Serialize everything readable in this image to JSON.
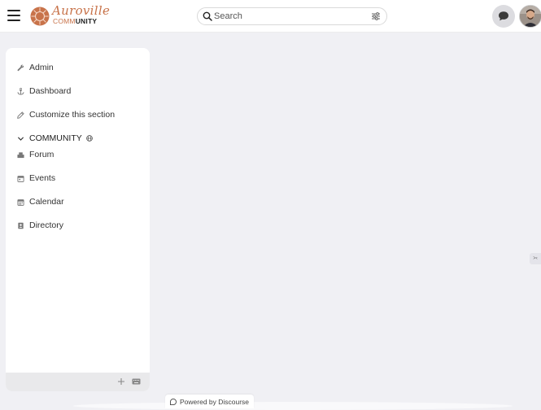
{
  "header": {
    "logo": {
      "script_text": "Auroville",
      "sub_prefix": "COMM",
      "sub_bold": "UNITY",
      "color": "#c8734a"
    },
    "search": {
      "placeholder": "Search",
      "value": ""
    },
    "icons": {
      "menu": "hamburger-icon",
      "search": "search-icon",
      "filter": "sliders-icon",
      "chat": "chat-bubble-icon"
    }
  },
  "sidebar": {
    "items": [
      {
        "label": "Admin",
        "icon": "wrench-icon"
      },
      {
        "label": "Dashboard",
        "icon": "anchor-icon"
      },
      {
        "label": "Customize this section",
        "icon": "pencil-icon"
      }
    ],
    "section": {
      "title": "COMMUNITY",
      "icon": "globe-icon",
      "items": [
        {
          "label": "Forum",
          "icon": "layer-group-icon"
        },
        {
          "label": "Events",
          "icon": "calendar-icon"
        },
        {
          "label": "Calendar",
          "icon": "calendar-days-icon"
        },
        {
          "label": "Directory",
          "icon": "address-book-icon"
        }
      ]
    },
    "footer": {
      "add_icon": "plus-icon",
      "keyboard_icon": "keyboard-icon"
    }
  },
  "footer": {
    "powered_by": "Powered by Discourse"
  },
  "colors": {
    "background": "#f0f0f4",
    "accent": "#c8734a",
    "sidebar": "#ffffff"
  }
}
